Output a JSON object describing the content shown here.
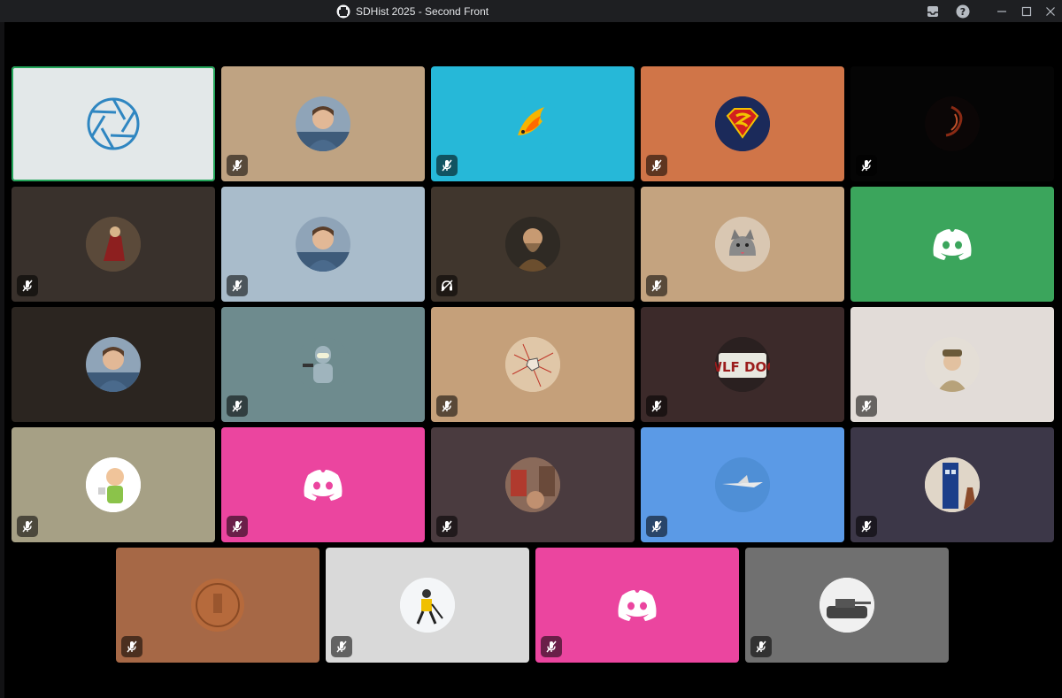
{
  "window": {
    "title": "SDHist 2025 - Second Front",
    "controls": {
      "inbox": "inbox-icon",
      "help": "help-icon",
      "minimize": "minimize-icon",
      "maximize": "maximize-icon",
      "close": "close-icon"
    }
  },
  "colors": {
    "titlebar": "#1e1f22",
    "speaking_border": "#23a55a",
    "stage": "#000000"
  },
  "tiles": [
    {
      "name": "tile-shutter",
      "bg": "#e3e8e9",
      "avatar": "aperture-icon",
      "speaking": true,
      "muted": false
    },
    {
      "name": "tile-man-glasses",
      "bg": "#bfa382",
      "avatar": "person-photo",
      "muted": true
    },
    {
      "name": "tile-fire-fish",
      "bg": "#26b8d8",
      "avatar": "flaming-fish-icon",
      "muted": true
    },
    {
      "name": "tile-superman",
      "bg": "#d07548",
      "avatar": "superman-logo",
      "muted": true
    },
    {
      "name": "tile-dark-flame",
      "bg": "#050505",
      "avatar": "dark-swirl",
      "muted": true
    },
    {
      "name": "tile-red-figure",
      "bg": "#39312c",
      "avatar": "painting-photo",
      "muted": true
    },
    {
      "name": "tile-man-smile",
      "bg": "#a9bccb",
      "avatar": "person-photo",
      "muted": true
    },
    {
      "name": "tile-bearded-portrait",
      "bg": "#40362d",
      "avatar": "portrait-painting",
      "muted": true,
      "deafened": true
    },
    {
      "name": "tile-cat",
      "bg": "#c4a37f",
      "avatar": "cat-photo",
      "muted": true
    },
    {
      "name": "tile-discord-green",
      "bg": "#3ba55c",
      "avatar": "discord-logo",
      "muted": false
    },
    {
      "name": "tile-older-man",
      "bg": "#2b2520",
      "avatar": "person-photo",
      "muted": false
    },
    {
      "name": "tile-bender",
      "bg": "#6e8b8e",
      "avatar": "robot-icon",
      "muted": true
    },
    {
      "name": "tile-map",
      "bg": "#c5a07a",
      "avatar": "map-image",
      "muted": true
    },
    {
      "name": "tile-wlf-dog",
      "bg": "#3c2a2a",
      "avatar": "license-plate",
      "muted": true
    },
    {
      "name": "tile-soldier",
      "bg": "#e2dcd8",
      "avatar": "soldier-photo",
      "muted": true
    },
    {
      "name": "tile-cartoon-mug",
      "bg": "#a6a085",
      "avatar": "cartoon-man",
      "muted": true
    },
    {
      "name": "tile-discord-pink",
      "bg": "#eb459f",
      "avatar": "discord-logo",
      "muted": true
    },
    {
      "name": "tile-street",
      "bg": "#4a3b3f",
      "avatar": "street-photo",
      "muted": true
    },
    {
      "name": "tile-jet",
      "bg": "#5b9ae6",
      "avatar": "jet-photo",
      "muted": true
    },
    {
      "name": "tile-tardis",
      "bg": "#3c3748",
      "avatar": "tardis-photo",
      "muted": true
    },
    {
      "name": "tile-coin",
      "bg": "#a66846",
      "avatar": "coin-image",
      "muted": true
    },
    {
      "name": "tile-hockey",
      "bg": "#d9d9d9",
      "avatar": "hockey-photo",
      "muted": true
    },
    {
      "name": "tile-discord-pink-2",
      "bg": "#eb459f",
      "avatar": "discord-logo",
      "muted": true
    },
    {
      "name": "tile-tank",
      "bg": "#707070",
      "avatar": "tank-photo",
      "muted": true
    }
  ]
}
